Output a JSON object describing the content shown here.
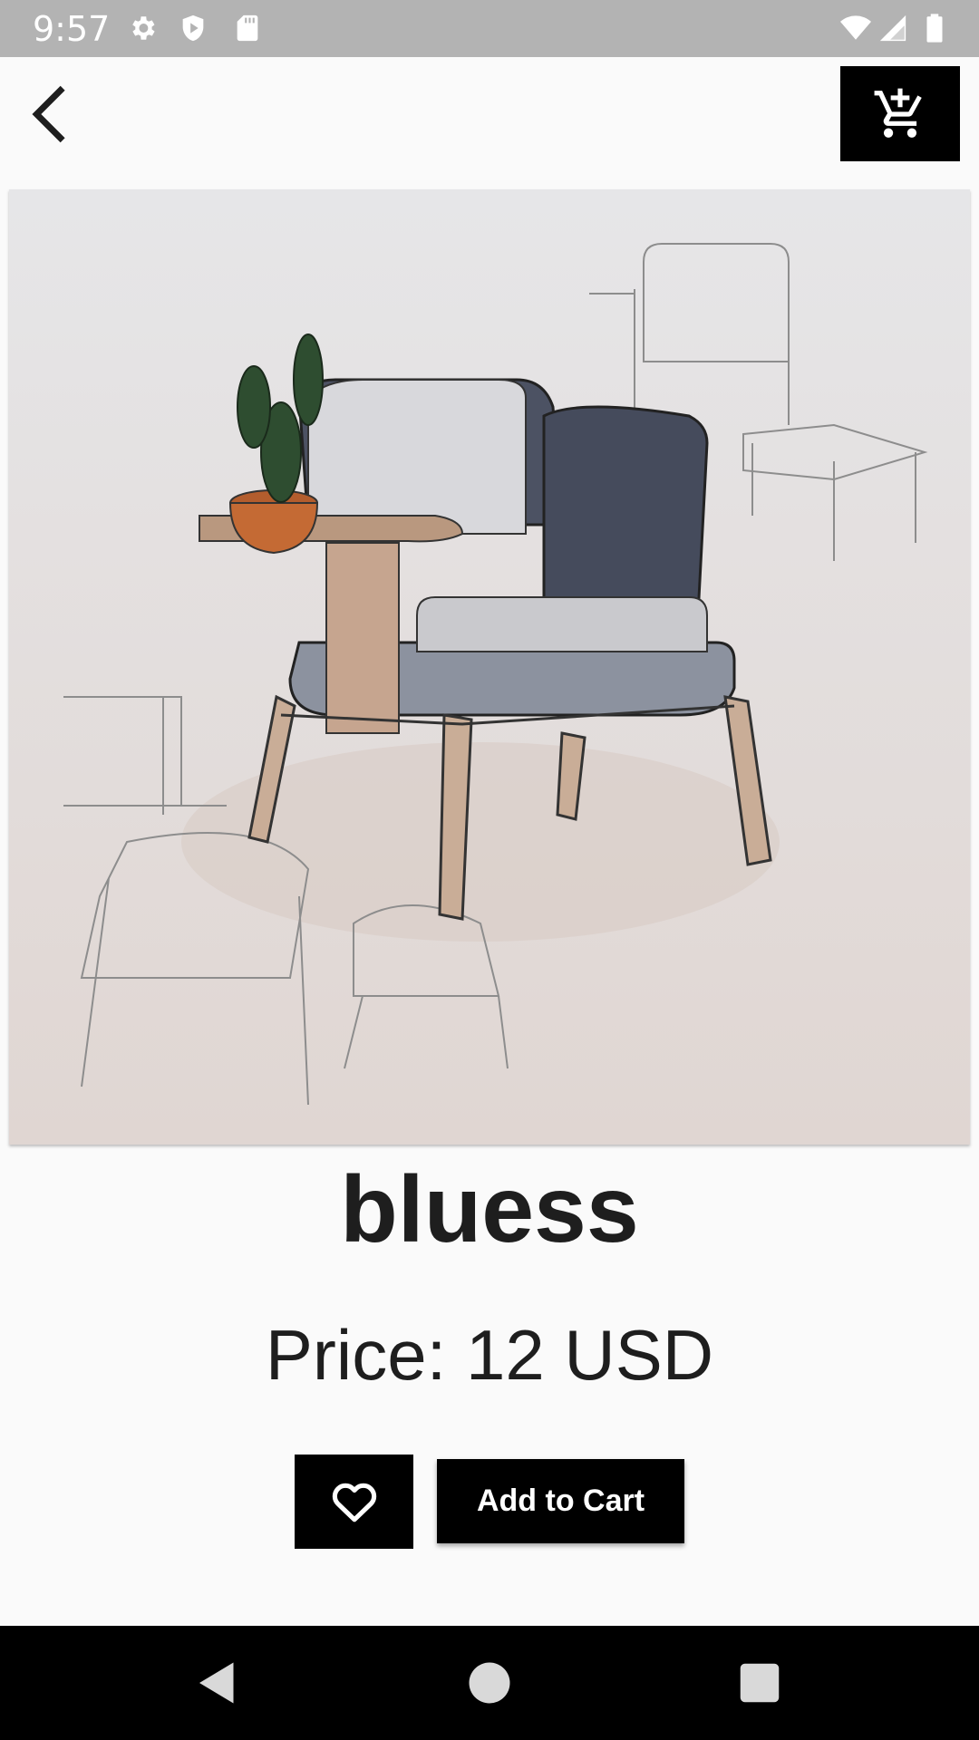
{
  "status_bar": {
    "time": "9:57",
    "left_icons": [
      "settings-icon",
      "shield-play-icon",
      "sd-card-icon"
    ],
    "right_icons": [
      "wifi-icon",
      "cell-signal-icon",
      "battery-icon"
    ]
  },
  "app_bar": {
    "back_icon": "chevron-left-icon",
    "cart_icon": "add-shopping-cart-icon"
  },
  "product": {
    "image_description_icon": "armchair-sketch-image",
    "name": "bluess",
    "price": "Price: 12 USD"
  },
  "actions": {
    "favorite_icon": "heart-outline-icon",
    "add_to_cart_label": "Add to Cart"
  },
  "nav_bar": {
    "icons": [
      "back-triangle-icon",
      "home-circle-icon",
      "recents-square-icon"
    ]
  },
  "colors": {
    "status_bar": "#b3b3b3",
    "background": "#fafafa",
    "button": "#000000",
    "text": "#1e1e1e"
  }
}
